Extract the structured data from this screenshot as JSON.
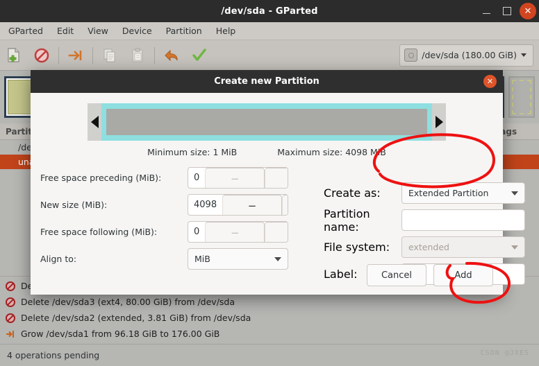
{
  "window": {
    "title": "/dev/sda - GParted",
    "minimize_label": "–",
    "maximize_label": "□",
    "close_label": "✕"
  },
  "menubar": {
    "items": [
      {
        "label": "GParted"
      },
      {
        "label": "Edit"
      },
      {
        "label": "View"
      },
      {
        "label": "Device"
      },
      {
        "label": "Partition"
      },
      {
        "label": "Help"
      }
    ]
  },
  "toolbar": {
    "buttons": [
      {
        "name": "new-partition-icon",
        "title": "New"
      },
      {
        "name": "delete-partition-icon",
        "title": "Delete"
      },
      {
        "name": "resize-move-icon",
        "title": "Resize/Move"
      },
      {
        "name": "copy-icon",
        "title": "Copy"
      },
      {
        "name": "paste-icon",
        "title": "Paste"
      },
      {
        "name": "undo-icon",
        "title": "Undo"
      },
      {
        "name": "apply-icon",
        "title": "Apply"
      }
    ],
    "device": {
      "label": "/dev/sda (180.00 GiB)",
      "icon": "disk-icon"
    }
  },
  "partition_table": {
    "headers": [
      "Partition",
      "Flags"
    ],
    "rows": [
      {
        "name": "/de",
        "selected": false
      },
      {
        "name": "una",
        "selected": true
      }
    ]
  },
  "dialog": {
    "title": "Create new Partition",
    "close_label": "✕",
    "minimum_size": "Minimum size: 1 MiB",
    "maximum_size": "Maximum size: 4098 MiB",
    "left_fields": [
      {
        "label": "Free space preceding (MiB):",
        "value": "0",
        "minus_enabled": false,
        "plus_enabled": true,
        "minus": "−",
        "plus": "+"
      },
      {
        "label": "New size (MiB):",
        "value": "4098",
        "minus_enabled": true,
        "plus_enabled": false,
        "minus": "−",
        "plus": "+"
      },
      {
        "label": "Free space following (MiB):",
        "value": "0",
        "minus_enabled": false,
        "plus_enabled": true,
        "minus": "−",
        "plus": "+"
      }
    ],
    "align_label": "Align to:",
    "align_value": "MiB",
    "right_fields": [
      {
        "label": "Create as:",
        "value": "Extended Partition",
        "type": "combo",
        "dim": false
      },
      {
        "label": "Partition name:",
        "value": "",
        "type": "text",
        "dim": false
      },
      {
        "label": "File system:",
        "value": "extended",
        "type": "combo",
        "dim": true
      },
      {
        "label": "Label:",
        "value": "",
        "type": "text",
        "dim": false
      }
    ],
    "cancel_label": "Cancel",
    "add_label": "Add"
  },
  "operations": {
    "rows": [
      {
        "icon": "delete-op-icon",
        "text": "De"
      },
      {
        "icon": "delete-op-icon",
        "text": "Delete /dev/sda3 (ext4, 80.00 GiB) from /dev/sda"
      },
      {
        "icon": "delete-op-icon",
        "text": "Delete /dev/sda2 (extended, 3.81 GiB) from /dev/sda"
      },
      {
        "icon": "grow-op-icon",
        "text": "Grow /dev/sda1 from 96.18 GiB to 176.00 GiB"
      }
    ]
  },
  "statusbar": {
    "text": "4 operations pending"
  },
  "watermark": {
    "text": "CSDN @JXES"
  },
  "colors": {
    "titlebar": "#2c2c2c",
    "close_button": "#d14520",
    "selection": "#c0431a",
    "slider_highlight": "#8fdfe0",
    "partition_fill": "#c3c58a",
    "annotation": "#ee1111"
  }
}
